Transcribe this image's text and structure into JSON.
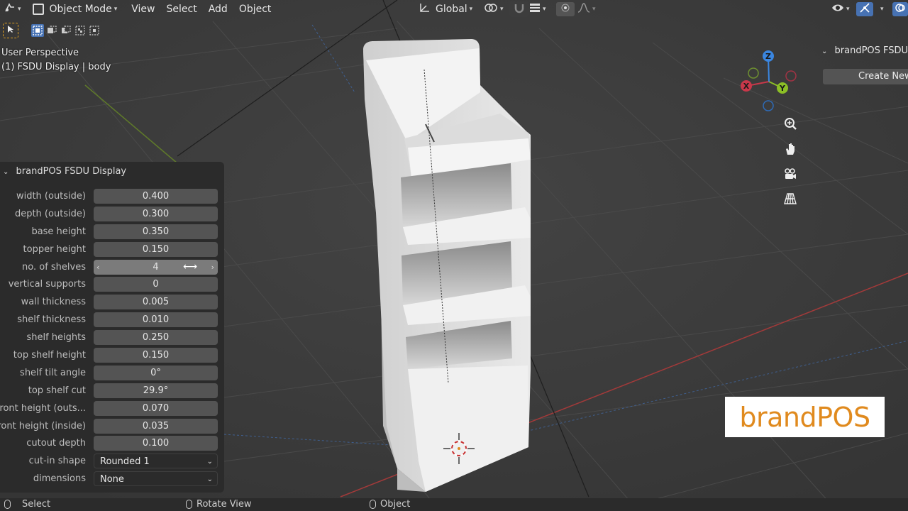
{
  "header": {
    "editor_icon": "editor-type-icon",
    "mode": "Object Mode",
    "menus": [
      "View",
      "Select",
      "Add",
      "Object"
    ],
    "transform_orientation": "Global"
  },
  "viewport": {
    "perspective_label": "User Perspective",
    "object_label": "(1) FSDU Display | body",
    "gizmo": {
      "x": "X",
      "y": "Y",
      "z": "Z"
    }
  },
  "sidebar": {
    "panel_title": "brandPOS FSDU D",
    "create_button": "Create New"
  },
  "panel": {
    "title": "brandPOS FSDU Display",
    "rows": [
      {
        "label": "width (outside)",
        "value": "0.400"
      },
      {
        "label": "depth (outside)",
        "value": "0.300"
      },
      {
        "label": "base height",
        "value": "0.350"
      },
      {
        "label": "topper height",
        "value": "0.150"
      },
      {
        "label": "no. of shelves",
        "value": "4"
      },
      {
        "label": "vertical supports",
        "value": "0"
      },
      {
        "label": "wall thickness",
        "value": "0.005"
      },
      {
        "label": "shelf thickness",
        "value": "0.010"
      },
      {
        "label": "shelf heights",
        "value": "0.250"
      },
      {
        "label": "top shelf height",
        "value": "0.150"
      },
      {
        "label": "shelf tilt angle",
        "value": "0°"
      },
      {
        "label": "top shelf cut",
        "value": "29.9°"
      },
      {
        "label": "front height (outs...",
        "value": "0.070"
      },
      {
        "label": "front height (inside)",
        "value": "0.035"
      },
      {
        "label": "cutout depth",
        "value": "0.100"
      },
      {
        "label": "cut-in shape",
        "value": "Rounded 1"
      },
      {
        "label": "dimensions",
        "value": "None"
      }
    ]
  },
  "logo": {
    "part1": "brand",
    "part2": "POS"
  },
  "status_bar": {
    "left": "Select",
    "middle": "Rotate View",
    "right": "Object"
  },
  "colors": {
    "accent": "#4772b3",
    "logo_orange": "#e08a1e",
    "axis_x": "#c8384a",
    "axis_y": "#8cbf26",
    "axis_z": "#3a86e0"
  }
}
